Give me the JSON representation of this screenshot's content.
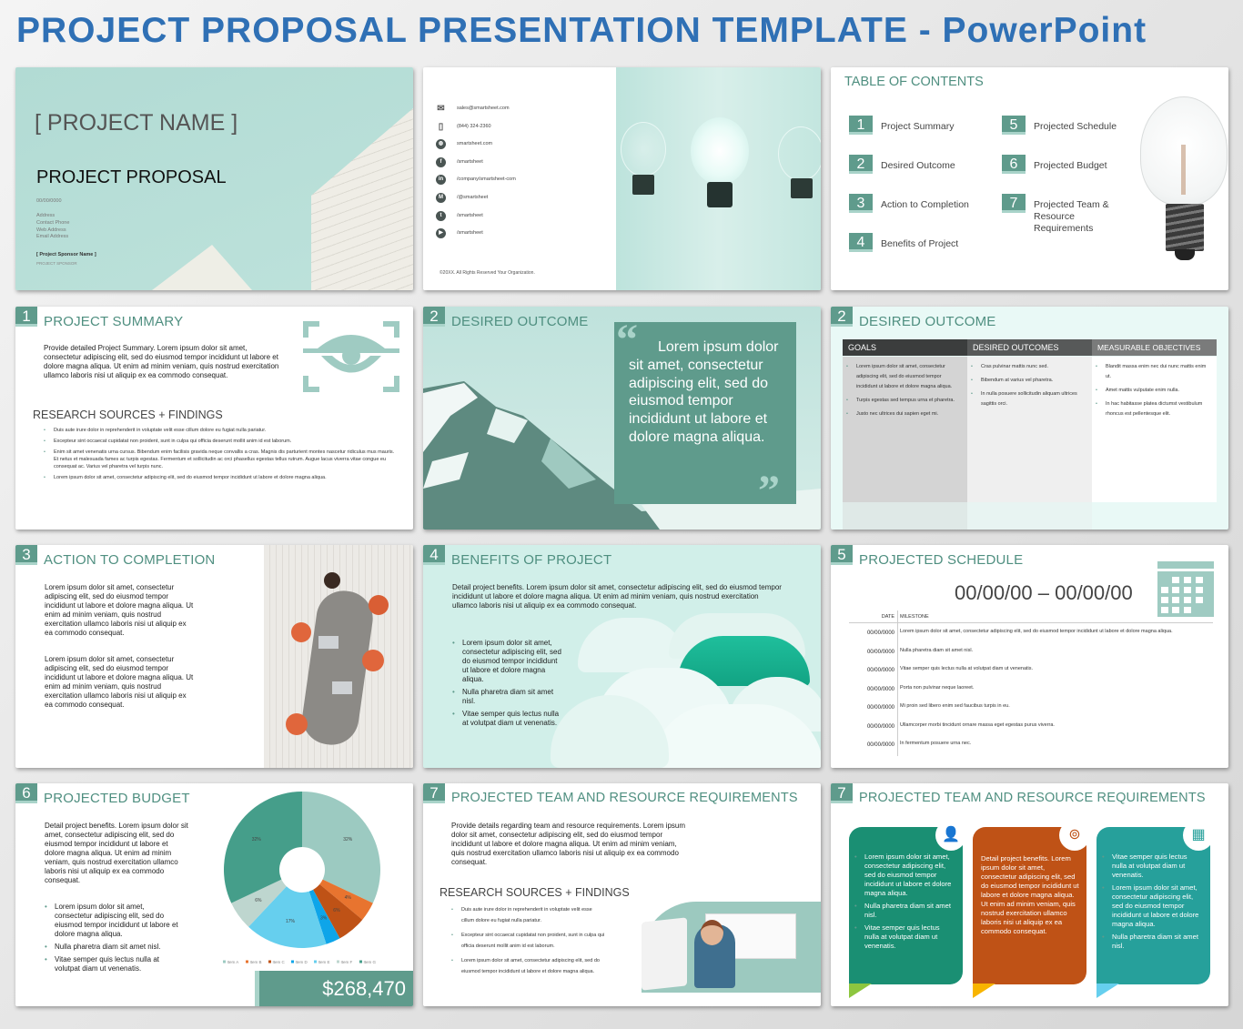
{
  "header": {
    "title_main": "PROJECT PROPOSAL PRESENTATION TEMPLATE - ",
    "title_app": "PowerPoint"
  },
  "colors": {
    "title": "#2f70b5",
    "accent": "#5f9b8c",
    "accent_light": "#a9d3c9",
    "orange": "#bf5216",
    "teal_dark": "#1a8f73",
    "teal": "#26a09b"
  },
  "cover": {
    "project_name": "[ PROJECT NAME ]",
    "subtitle": "PROJECT PROPOSAL",
    "date": "00/00/0000",
    "lines": [
      "Address",
      "Contact Phone",
      "Web Address",
      "Email Address"
    ],
    "sponsor_name": "[ Project Sponsor Name ]",
    "sponsor_label": "PROJECT SPONSOR"
  },
  "contact": {
    "items": [
      {
        "icon": "envelope-icon",
        "text": "sales@smartsheet.com"
      },
      {
        "icon": "phone-icon",
        "text": "(844) 324-2360"
      },
      {
        "icon": "globe-icon",
        "text": "smartsheet.com"
      },
      {
        "icon": "facebook-icon",
        "text": "/smartsheet"
      },
      {
        "icon": "linkedin-icon",
        "text": "/company/smartsheet-com"
      },
      {
        "icon": "medium-icon",
        "text": "/@smartsheet"
      },
      {
        "icon": "twitter-icon",
        "text": "/smartsheet"
      },
      {
        "icon": "youtube-icon",
        "text": "/smartsheet"
      }
    ],
    "copyright": "©20XX. All Rights Reserved Your Organization."
  },
  "toc": {
    "title": "TABLE OF CONTENTS",
    "items": [
      {
        "num": "1",
        "label": "Project Summary"
      },
      {
        "num": "2",
        "label": "Desired Outcome"
      },
      {
        "num": "3",
        "label": "Action to Completion"
      },
      {
        "num": "4",
        "label": "Benefits of Project"
      },
      {
        "num": "5",
        "label": "Projected Schedule"
      },
      {
        "num": "6",
        "label": "Projected Budget"
      },
      {
        "num": "7",
        "label": "Projected Team & Resource Requirements"
      }
    ]
  },
  "summary": {
    "num": "1",
    "title": "PROJECT SUMMARY",
    "body": "Provide detailed Project Summary. Lorem ipsum dolor sit amet, consectetur adipiscing elit, sed do eiusmod tempor incididunt ut labore et dolore magna aliqua. Ut enim ad minim veniam, quis nostrud exercitation ullamco laboris nisi ut aliquip ex ea commodo consequat.",
    "research_title": "RESEARCH SOURCES + FINDINGS",
    "bullets": [
      "Duis aute irure dolor in reprehenderit in voluptate velit esse cillum dolore eu fugiat nulla pariatur.",
      "Excepteur sint occaecat cupidatat non proident, sunt in culpa qui officia deserunt mollit anim id est laborum.",
      "Enim sit amet venenatis urna cursus. Bibendum enim facilisis gravida neque convallis a cras. Magnis dis parturient montes nascetur ridiculus mus mauris. Et netus et malesuada fames ac turpis egestas. Fermentum et sollicitudin ac orci phasellus egestas tellus rutrum. Augue lacus viverra vitae congue eu consequat ac. Varius vel pharetra vel turpis nunc.",
      "Lorem ipsum dolor sit amet, consectetur adipiscing elit, sed do eiusmod tempor incididunt ut labore et dolore magna aliqua."
    ]
  },
  "outcome_quote": {
    "num": "2",
    "title": "DESIRED OUTCOME",
    "quote": "Lorem ipsum dolor sit amet, consectetur adipiscing elit, sed do eiusmod tempor incididunt ut labore et dolore magna aliqua.",
    "open_mark": "“",
    "close_mark": "”"
  },
  "outcome_table": {
    "num": "2",
    "title": "DESIRED OUTCOME",
    "columns": [
      "GOALS",
      "DESIRED OUTCOMES",
      "MEASURABLE OBJECTIVES"
    ],
    "goals": [
      "Lorem ipsum dolor sit amet, consectetur adipiscing elit, sed do eiusmod tempor incididunt ut labore et dolore magna aliqua.",
      "Turpis egestas sed tempus urna et pharetra.",
      "Justo nec ultrices dui sapien eget mi."
    ],
    "outcomes": [
      "Cras pulvinar mattis nunc sed.",
      "Bibendum at varius vel pharetra.",
      "In nulla posuere sollicitudin aliquam ultrices sagittis orci."
    ],
    "objectives": [
      "Blandit massa enim nec dui nunc mattis enim ut.",
      "Amet mattis vulputate enim nulla.",
      "In hac habitasse platea dictumst vestibulum rhoncus est pellentesque elit."
    ]
  },
  "action": {
    "num": "3",
    "title": "ACTION TO COMPLETION",
    "paragraphs": [
      "Lorem ipsum dolor sit amet, consectetur adipiscing elit, sed do eiusmod tempor incididunt ut labore et dolore magna aliqua. Ut enim ad minim veniam, quis nostrud exercitation ullamco laboris nisi ut aliquip ex ea commodo consequat.",
      "Lorem ipsum dolor sit amet, consectetur adipiscing elit, sed do eiusmod tempor incididunt ut labore et dolore magna aliqua. Ut enim ad minim veniam, quis nostrud exercitation ullamco laboris nisi ut aliquip ex ea commodo consequat."
    ]
  },
  "benefits": {
    "num": "4",
    "title": "BENEFITS OF PROJECT",
    "body": "Detail project benefits. Lorem ipsum dolor sit amet, consectetur adipiscing elit, sed do eiusmod tempor incididunt ut labore et dolore magna aliqua. Ut enim ad minim veniam, quis nostrud exercitation ullamco laboris nisi ut aliquip ex ea commodo consequat.",
    "bullets": [
      "Lorem ipsum dolor sit amet, consectetur adipiscing elit, sed do eiusmod tempor incididunt ut labore et dolore magna aliqua.",
      "Nulla pharetra diam sit amet nisl.",
      "Vitae semper quis lectus nulla at volutpat diam ut venenatis."
    ]
  },
  "schedule": {
    "num": "5",
    "title": "PROJECTED SCHEDULE",
    "range": "00/00/00 – 00/00/00",
    "date_header": "DATE",
    "milestone_header": "MILESTONE",
    "rows": [
      {
        "date": "00/00/0000",
        "milestone": "Lorem ipsum dolor sit amet, consectetur adipiscing elit, sed do eiusmod tempor incididunt ut labore et dolore magna aliqua."
      },
      {
        "date": "00/00/0000",
        "milestone": "Nulla pharetra diam sit amet nisl."
      },
      {
        "date": "00/00/0000",
        "milestone": "Vitae semper quis lectus nulla at volutpat diam ut venenatis."
      },
      {
        "date": "00/00/0000",
        "milestone": "Porta non pulvinar neque laoreet."
      },
      {
        "date": "00/00/0000",
        "milestone": "Mi proin sed libero enim sed faucibus turpis in eu."
      },
      {
        "date": "00/00/0000",
        "milestone": "Ullamcorper morbi tincidunt ornare massa eget egestas purus viverra."
      },
      {
        "date": "00/00/0000",
        "milestone": "In fermentum posuere urna nec."
      }
    ]
  },
  "budget": {
    "num": "6",
    "title": "PROJECTED BUDGET",
    "body": "Detail project benefits. Lorem ipsum dolor sit amet, consectetur adipiscing elit, sed do eiusmod tempor incididunt ut labore et dolore magna aliqua. Ut enim ad minim veniam, quis nostrud exercitation ullamco laboris nisi ut aliquip ex ea commodo consequat.",
    "bullets": [
      "Lorem ipsum dolor sit amet, consectetur adipiscing elit, sed do eiusmod tempor incididunt ut labore et dolore magna aliqua.",
      "Nulla pharetra diam sit amet nisl.",
      "Vitae semper quis lectus nulla at volutpat diam ut venenatis."
    ],
    "total": "$268,470"
  },
  "chart_data": {
    "type": "pie",
    "donut": true,
    "categories": [
      "Item A",
      "Item B",
      "Item C",
      "Item D",
      "Item E",
      "Item F",
      "Item G"
    ],
    "values": [
      32,
      4,
      6,
      3,
      17,
      6,
      32
    ],
    "unit": "%",
    "colors": [
      "#9ccac1",
      "#e8742f",
      "#bf5216",
      "#0ea5e9",
      "#66cfee",
      "#bed6cf",
      "#459e8a"
    ],
    "legend": "bottom"
  },
  "team1": {
    "num": "7",
    "title": "PROJECTED TEAM AND RESOURCE REQUIREMENTS",
    "body": "Provide details regarding team and resource requirements. Lorem ipsum dolor sit amet, consectetur adipiscing elit, sed do eiusmod tempor incididunt ut labore et dolore magna aliqua. Ut enim ad minim veniam, quis nostrud exercitation ullamco laboris nisi ut aliquip ex ea commodo consequat.",
    "research_title": "RESEARCH SOURCES + FINDINGS",
    "bullets": [
      "Duis aute irure dolor in reprehenderit in voluptate velit esse cillum dolore eu fugiat nulla pariatur.",
      "Excepteur sint occaecat cupidatat non proident, sunt in culpa qui officia deserunt mollit anim id est laborum.",
      "Lorem ipsum dolor sit amet, consectetur adipiscing elit, sed do eiusmod tempor incididunt ut labore et dolore magna aliqua."
    ]
  },
  "team2": {
    "num": "7",
    "title": "PROJECTED TEAM AND RESOURCE REQUIREMENTS",
    "cards": [
      {
        "icon": "add-user-icon",
        "color": "#1a8f73",
        "tail": "#8dc63f",
        "bullets": [
          "Lorem ipsum dolor sit amet, consectetur adipiscing elit, sed do eiusmod tempor incididunt ut labore et dolore magna aliqua.",
          "Nulla pharetra diam sit amet nisl.",
          "Vitae semper quis lectus nulla at volutpat diam ut venenatis."
        ]
      },
      {
        "icon": "location-pins-icon",
        "color": "#bf5216",
        "tail": "#f8b400",
        "text": "Detail project benefits. Lorem ipsum dolor sit amet, consectetur adipiscing elit, sed do eiusmod tempor incididunt ut labore et dolore magna aliqua. Ut enim ad minim veniam, quis nostrud exercitation ullamco laboris nisi ut aliquip ex ea commodo consequat."
      },
      {
        "icon": "database-sheet-icon",
        "color": "#26a09b",
        "tail": "#66cfee",
        "bullets": [
          "Vitae semper quis lectus nulla at volutpat diam ut venenatis.",
          "Lorem ipsum dolor sit amet, consectetur adipiscing elit, sed do eiusmod tempor incididunt ut labore et dolore magna aliqua.",
          "Nulla pharetra diam sit amet nisl."
        ]
      }
    ]
  }
}
